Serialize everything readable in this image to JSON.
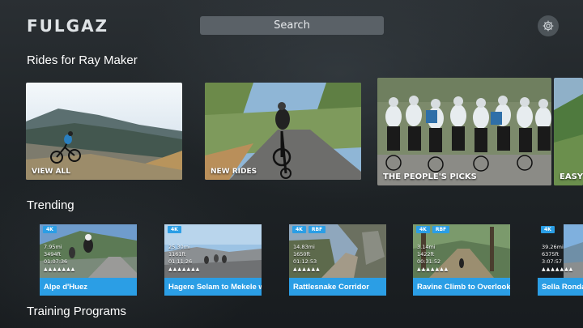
{
  "header": {
    "logo": "FULGAZ",
    "search_label": "Search",
    "settings_icon": "gear-icon"
  },
  "sections": {
    "rides_title": "Rides for Ray Maker",
    "trending_title": "Trending",
    "training_title": "Training Programs"
  },
  "categories": [
    {
      "label": "VIEW ALL"
    },
    {
      "label": "NEW RIDES"
    },
    {
      "label": "THE PEOPLE'S PICKS"
    },
    {
      "label": "EASY"
    }
  ],
  "trending": [
    {
      "title": "Alpe d'Huez",
      "badges": [
        "4K"
      ],
      "distance": "7.95mi",
      "elevation": "3494ft",
      "duration": "01:07:36",
      "difficulty": "▲▲▲▲▲▲▲"
    },
    {
      "title": "Hagere Selam to Mekele wi",
      "badges": [
        "4K"
      ],
      "distance": "25.30mi",
      "elevation": "1161ft",
      "duration": "01:11:26",
      "difficulty": "▲▲▲▲▲▲▲"
    },
    {
      "title": "Rattlesnake Corridor",
      "badges": [
        "4K",
        "RBF"
      ],
      "distance": "14.83mi",
      "elevation": "1650ft",
      "duration": "01:12:53",
      "difficulty": "▲▲▲▲▲▲"
    },
    {
      "title": "Ravine Climb to Overlook",
      "badges": [
        "4K",
        "RBF"
      ],
      "distance": "3.14mi",
      "elevation": "1422ft",
      "duration": "00:31:52",
      "difficulty": "▲▲▲▲▲▲▲"
    },
    {
      "title": "Sella Ronda (",
      "badges": [
        "4K"
      ],
      "distance": "39.26mi",
      "elevation": "6375ft",
      "duration": "3:07:57",
      "difficulty": "▲▲▲▲▲▲▲"
    }
  ],
  "colors": {
    "accent": "#2b9ee5",
    "search_bg": "#5a6167"
  }
}
